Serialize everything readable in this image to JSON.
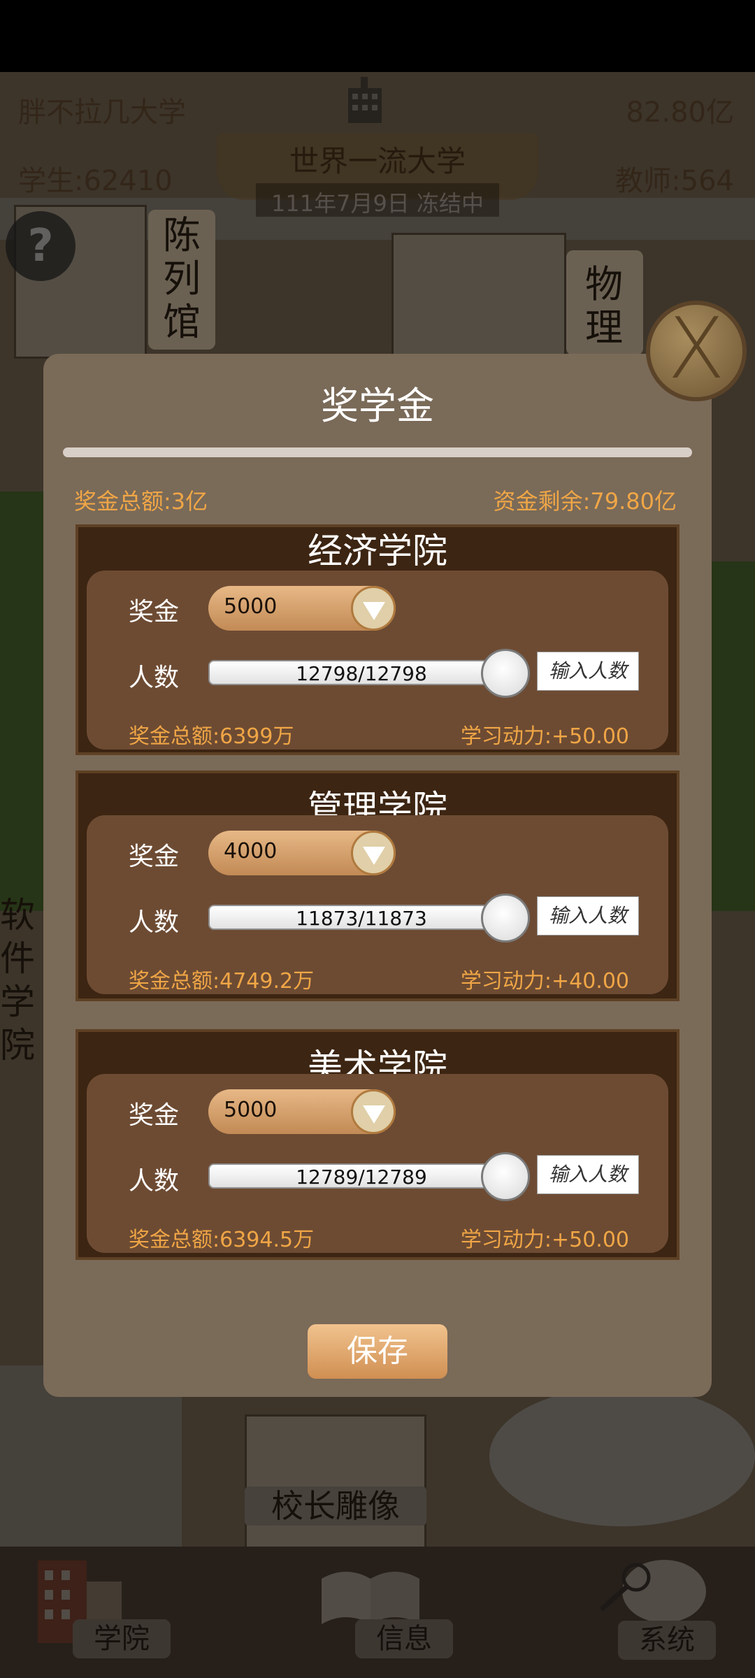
{
  "hud": {
    "university_name": "胖不拉几大学",
    "funds": "82.80亿",
    "students": "学生:62410",
    "teachers": "教师:564",
    "rank_title": "世界一流大学",
    "date_status": "111年7月9日 冻结中",
    "help_symbol": "?"
  },
  "map_labels": {
    "exhibition": "陈列馆",
    "physics": "物理",
    "software": "软件学院",
    "statue": "校长雕像"
  },
  "dialog": {
    "title": "奖学金",
    "close_symbol": "X",
    "total_bonus": "奖金总额:3亿",
    "funds_remaining": "资金剩余:79.80亿",
    "bonus_label": "奖金",
    "count_label": "人数",
    "input_placeholder": "输入人数",
    "save_label": "保存",
    "colleges": [
      {
        "name": "经济学院",
        "bonus": "5000",
        "count": "12798/12798",
        "count_fill": 1.0,
        "total": "奖金总额:6399万",
        "motivation": "学习动力:+50.00"
      },
      {
        "name": "管理学院",
        "bonus": "4000",
        "count": "11873/11873",
        "count_fill": 1.0,
        "total": "奖金总额:4749.2万",
        "motivation": "学习动力:+40.00"
      },
      {
        "name": "美术学院",
        "bonus": "5000",
        "count": "12789/12789",
        "count_fill": 1.0,
        "total": "奖金总额:6394.5万",
        "motivation": "学习动力:+50.00"
      }
    ]
  },
  "bottom_nav": {
    "college": "学院",
    "info": "信息",
    "system": "系统"
  },
  "colors": {
    "accent_orange": "#f0a646",
    "dialog_bg": "#7a6a58",
    "college_bg": "#3c2512"
  }
}
